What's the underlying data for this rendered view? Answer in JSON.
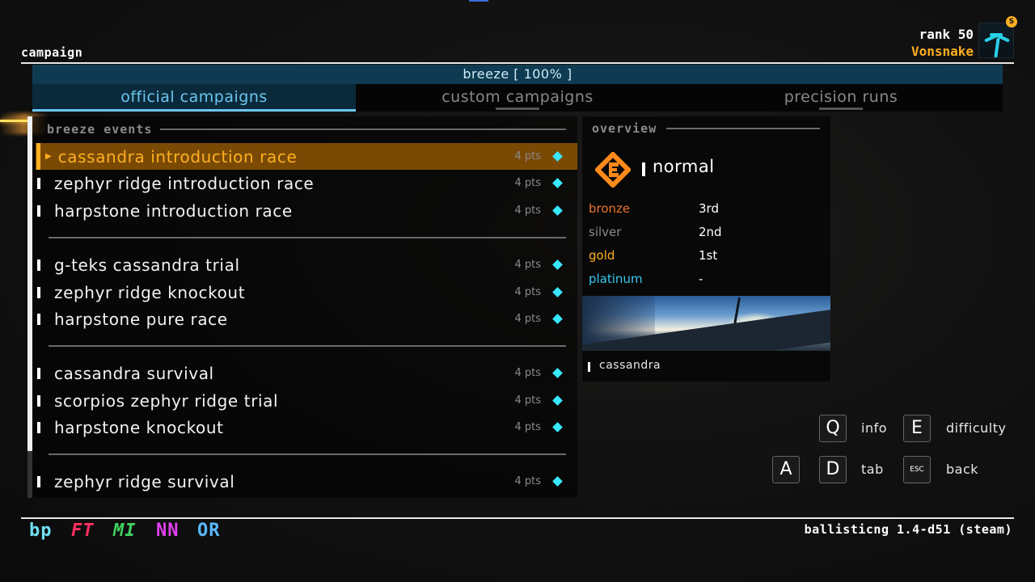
{
  "header": {
    "mode_title": "campaign",
    "rank_label": "rank 50",
    "player_name": "Vonsnake",
    "badge_letter": "S"
  },
  "subheader": {
    "campaign_title": "breeze [ 100% ]"
  },
  "tabs": [
    {
      "label": "official campaigns",
      "active": true
    },
    {
      "label": "custom campaigns",
      "active": false
    },
    {
      "label": "precision runs",
      "active": false
    }
  ],
  "events_section": {
    "title": "breeze events",
    "events": [
      {
        "name": "cassandra introduction race",
        "pts": "4 pts",
        "selected": true
      },
      {
        "name": "zephyr ridge introduction race",
        "pts": "4 pts"
      },
      {
        "name": "harpstone introduction race",
        "pts": "4 pts"
      },
      {
        "name": "g-teks cassandra trial",
        "pts": "4 pts"
      },
      {
        "name": "zephyr ridge knockout",
        "pts": "4 pts"
      },
      {
        "name": "harpstone pure race",
        "pts": "4 pts"
      },
      {
        "name": "cassandra survival",
        "pts": "4 pts"
      },
      {
        "name": "scorpios zephyr ridge trial",
        "pts": "4 pts"
      },
      {
        "name": "harpstone knockout",
        "pts": "4 pts"
      },
      {
        "name": "zephyr ridge survival",
        "pts": "4 pts"
      }
    ]
  },
  "overview": {
    "title": "overview",
    "difficulty": "normal",
    "medals": [
      {
        "label": "bronze",
        "value": "3rd",
        "color": "#e8732a"
      },
      {
        "label": "silver",
        "value": "2nd",
        "color": "#8a8a8a"
      },
      {
        "label": "gold",
        "value": "1st",
        "color": "#ffb020"
      },
      {
        "label": "platinum",
        "value": "-",
        "color": "#38c8f0"
      }
    ],
    "track_name": "cassandra"
  },
  "controls": [
    {
      "key": "Q",
      "label": "info"
    },
    {
      "key": "E",
      "label": "difficulty"
    },
    {
      "key": "A",
      "label": ""
    },
    {
      "key": "D",
      "label": "tab"
    },
    {
      "key": "ESC",
      "label": "back"
    }
  ],
  "teams": [
    {
      "tag": "bp",
      "color": "#6ee0f0"
    },
    {
      "tag": "FT",
      "color": "#ff3060"
    },
    {
      "tag": "MI",
      "color": "#40d060"
    },
    {
      "tag": "NN",
      "color": "#e040f0"
    },
    {
      "tag": "OR",
      "color": "#58b8ff"
    }
  ],
  "version": "ballisticng 1.4-d51 (steam)",
  "colors": {
    "accent": "#ffb020",
    "highlight": "#6cc7ef",
    "diamond": "#38e8ff"
  }
}
